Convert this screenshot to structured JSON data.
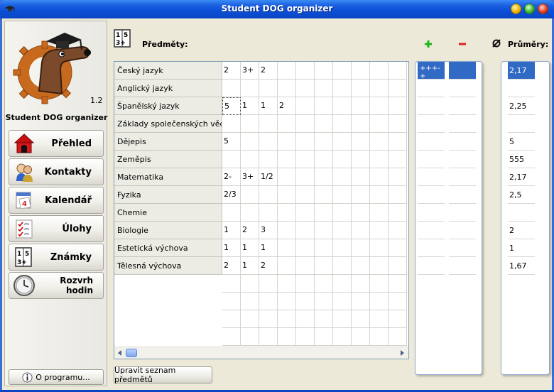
{
  "window": {
    "title": "Student DOG organizer"
  },
  "sidebar": {
    "version": "1.2",
    "app_name": "Student DOG organizer",
    "items": [
      {
        "label": "Přehled",
        "icon": "house-icon"
      },
      {
        "label": "Kontakty",
        "icon": "contacts-icon"
      },
      {
        "label": "Kalendář",
        "icon": "calendar-icon"
      },
      {
        "label": "Úlohy",
        "icon": "tasks-icon"
      },
      {
        "label": "Známky",
        "icon": "grades-icon"
      },
      {
        "label": "Rozvrh hodin",
        "icon": "clock-icon"
      }
    ],
    "about_label": "O programu..."
  },
  "main": {
    "subjects_label": "Předměty:",
    "averages_label": "Průměry:",
    "edit_button_label": "Upravit seznam předmětů",
    "subjects": [
      {
        "name": "Český jazyk",
        "grades": [
          "2",
          "3+",
          "2"
        ]
      },
      {
        "name": "Anglický jazyk",
        "grades": []
      },
      {
        "name": "Španělský jazyk",
        "grades": [
          "5",
          "1",
          "1",
          "2"
        ]
      },
      {
        "name": "Základy společenských věd",
        "grades": []
      },
      {
        "name": "Dějepis",
        "grades": [
          "5"
        ]
      },
      {
        "name": "Zeměpis",
        "grades": []
      },
      {
        "name": "Matematika",
        "grades": [
          "2-",
          "3+",
          "1/2"
        ]
      },
      {
        "name": "Fyzika",
        "grades": [
          "2/3"
        ]
      },
      {
        "name": "Chemie",
        "grades": []
      },
      {
        "name": "Biologie",
        "grades": [
          "1",
          "2",
          "3"
        ]
      },
      {
        "name": "Estetická výchova",
        "grades": [
          "1",
          "1",
          "1"
        ]
      },
      {
        "name": "Tělesná výchova",
        "grades": [
          "2",
          "1",
          "2"
        ]
      }
    ],
    "plus_values": [
      "+++-+",
      "",
      "",
      "",
      "",
      "",
      "",
      "",
      "",
      "",
      "",
      ""
    ],
    "averages": [
      "2,17",
      "",
      "2,25",
      "",
      "5",
      "555",
      "2,17",
      "2,5",
      "",
      "2",
      "1",
      "1,67"
    ],
    "colors": {
      "selection": "#316ac5",
      "plus": "#1fb41f",
      "minus": "#e02020"
    }
  }
}
